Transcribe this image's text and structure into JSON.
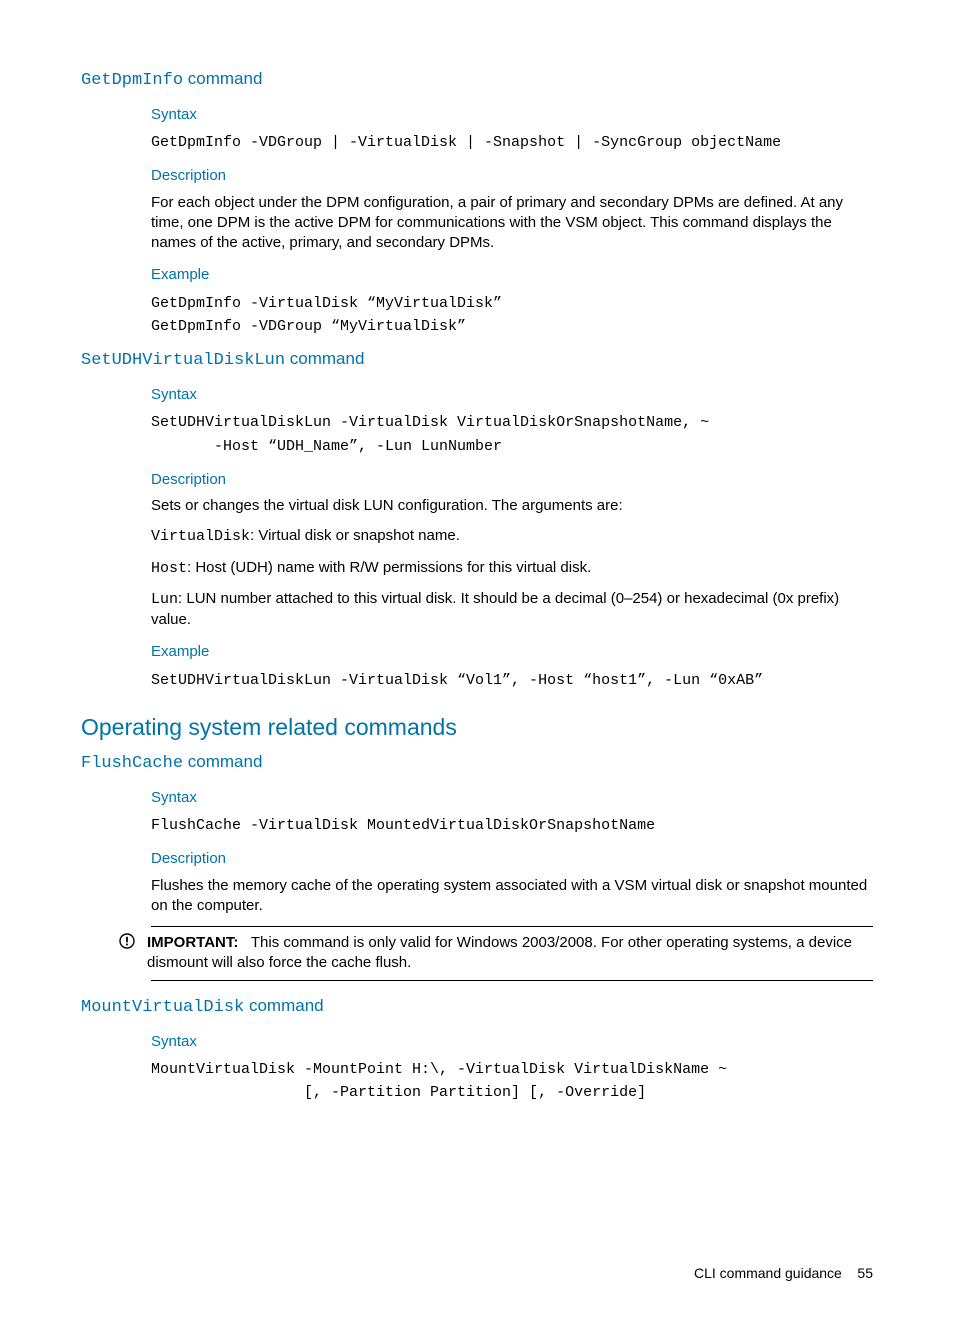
{
  "cmd1": {
    "title_code": "GetDpmInfo",
    "title_suffix": " command",
    "syntax_label": "Syntax",
    "syntax_code": "GetDpmInfo -VDGroup | -VirtualDisk | -Snapshot | -SyncGroup objectName",
    "desc_label": "Description",
    "desc_text": "For each object under the DPM configuration, a pair of primary and secondary DPMs are defined. At any time, one DPM is the active DPM for communications with the VSM object. This command displays the names of the active, primary, and secondary DPMs.",
    "example_label": "Example",
    "example_code": "GetDpmInfo -VirtualDisk “MyVirtualDisk”\nGetDpmInfo -VDGroup “MyVirtualDisk”"
  },
  "cmd2": {
    "title_code": "SetUDHVirtualDiskLun",
    "title_suffix": " command",
    "syntax_label": "Syntax",
    "syntax_code": "SetUDHVirtualDiskLun -VirtualDisk VirtualDiskOrSnapshotName, ~\n       -Host “UDH_Name”, -Lun LunNumber",
    "desc_label": "Description",
    "desc_intro": "Sets or changes the virtual disk LUN configuration. The arguments are:",
    "arg1_code": "VirtualDisk",
    "arg1_text": ": Virtual disk or snapshot name.",
    "arg2_code": "Host",
    "arg2_text": ": Host (UDH) name with R/W permissions for this virtual disk.",
    "arg3_code": "Lun",
    "arg3_text": ": LUN number attached to this virtual disk. It should be a decimal (0–254) or hexadecimal (0x prefix) value.",
    "example_label": "Example",
    "example_code": "SetUDHVirtualDiskLun -VirtualDisk “Vol1”, -Host “host1”, -Lun “0xAB”"
  },
  "section": {
    "title": "Operating system related commands"
  },
  "cmd3": {
    "title_code": "FlushCache",
    "title_suffix": " command",
    "syntax_label": "Syntax",
    "syntax_code": "FlushCache -VirtualDisk MountedVirtualDiskOrSnapshotName",
    "desc_label": "Description",
    "desc_text": "Flushes the memory cache of the operating system associated with a VSM virtual disk or snapshot mounted on the computer.",
    "note_label": "IMPORTANT:",
    "note_text": "   This command is only valid for Windows 2003/2008. For other operating systems, a device dismount will also force the cache flush."
  },
  "cmd4": {
    "title_code": "MountVirtualDisk",
    "title_suffix": " command",
    "syntax_label": "Syntax",
    "syntax_code": "MountVirtualDisk -MountPoint H:\\, -VirtualDisk VirtualDiskName ~\n                 [, -Partition Partition] [, -Override]"
  },
  "footer": {
    "text": "CLI command guidance",
    "page": "55"
  }
}
